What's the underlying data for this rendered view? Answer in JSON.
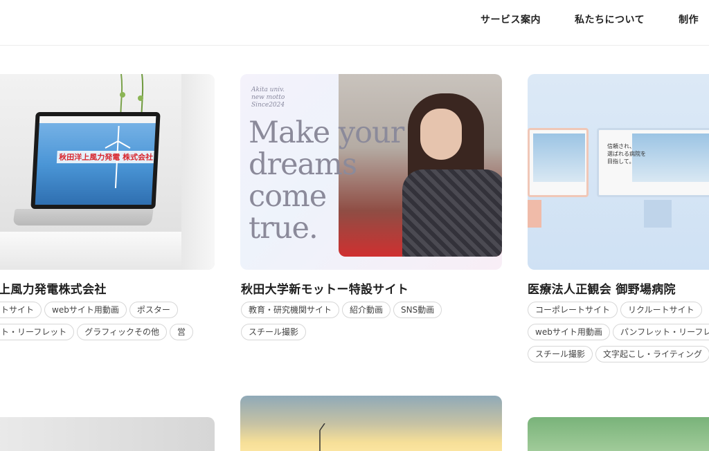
{
  "nav": {
    "items": [
      "サービス案内",
      "私たちについて",
      "制作"
    ]
  },
  "cards": [
    {
      "title": "上風力発電株式会社",
      "thumb_text": "秋田洋上風力発電 株式会社",
      "tags": [
        "ートサイト",
        "webサイト用動画",
        "ポスター",
        "ット・リーフレット",
        "グラフィックその他",
        "営"
      ]
    },
    {
      "title": "秋田大学新モットー特設サイト",
      "thumb_small": [
        "Akita univ.",
        "new motto",
        "Since2024"
      ],
      "thumb_big": [
        "Make your",
        "dreams",
        "come",
        "true."
      ],
      "tags": [
        "教育・研究機関サイト",
        "紹介動画",
        "SNS動画",
        "スチール撮影"
      ]
    },
    {
      "title": "医療法人正観会 御野場病院",
      "thumb_text": [
        "信頼され、",
        "選ばれる病院を",
        "目指して。"
      ],
      "tags": [
        "コーポレートサイト",
        "リクルートサイト",
        "webサイト用動画",
        "パンフレット・リーフレ",
        "スチール撮影",
        "文字起こし・ライティング"
      ]
    }
  ]
}
